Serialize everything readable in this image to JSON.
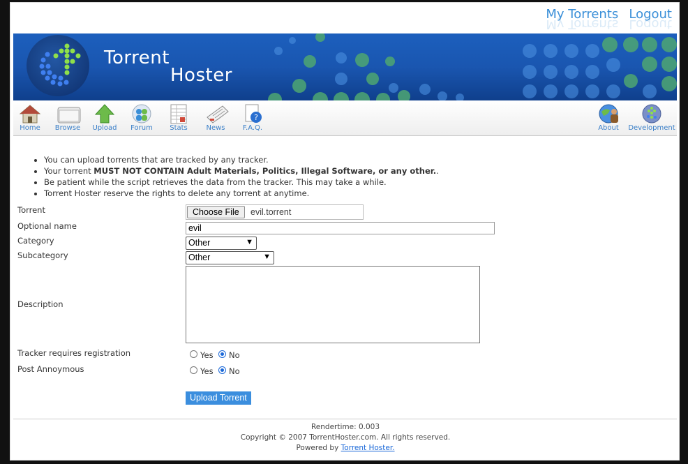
{
  "top_links": {
    "my_torrents": "My Torrents",
    "logout": "Logout"
  },
  "brand": {
    "line1": "Torrent",
    "line2": "Hoster"
  },
  "nav": {
    "home": "Home",
    "browse": "Browse",
    "upload": "Upload",
    "forum": "Forum",
    "stats": "Stats",
    "news": "News",
    "faq": "F.A.Q.",
    "about": "About",
    "development": "Development"
  },
  "rules": {
    "r1": "You can upload torrents that are tracked by any tracker.",
    "r2_pre": "Your torrent ",
    "r2_bold": "MUST NOT CONTAIN Adult Materials, Politics, Illegal Software, or any other.",
    "r2_post": ".",
    "r3": "Be patient while the script retrieves the data from the tracker. This may take a while.",
    "r4": "Torrent Hoster reserve the rights to delete any torrent at anytime."
  },
  "form": {
    "torrent_label": "Torrent",
    "file_button": "Choose File",
    "file_name": "evil.torrent",
    "optional_name_label": "Optional name",
    "optional_name_value": "evil",
    "category_label": "Category",
    "category_value": "Other",
    "subcategory_label": "Subcategory",
    "subcategory_value": "Other",
    "description_label": "Description",
    "description_value": "",
    "tracker_reg_label": "Tracker requires registration",
    "post_anon_label": "Post Annoymous",
    "yes": "Yes",
    "no": "No",
    "tracker_reg_selected": "No",
    "post_anon_selected": "No",
    "submit": "Upload Torrent"
  },
  "footer": {
    "rendertime": "Rendertime: 0.003",
    "copyright": "Copyright © 2007 TorrentHoster.com. All rights reserved.",
    "powered_pre": "Powered by ",
    "powered_link": "Torrent Hoster."
  },
  "colors": {
    "banner": "#1a56b0",
    "accent": "#3a8fd8",
    "dots_green": "#5fbf7a",
    "dots_blue": "#4a8fe0"
  },
  "icons": {
    "home": "house-icon",
    "browse": "folder-icon",
    "upload": "up-arrow-icon",
    "forum": "people-icon",
    "stats": "spreadsheet-icon",
    "news": "newspaper-icon",
    "faq": "help-document-icon",
    "about": "globe-person-icon",
    "development": "globe-arrow-icon"
  }
}
